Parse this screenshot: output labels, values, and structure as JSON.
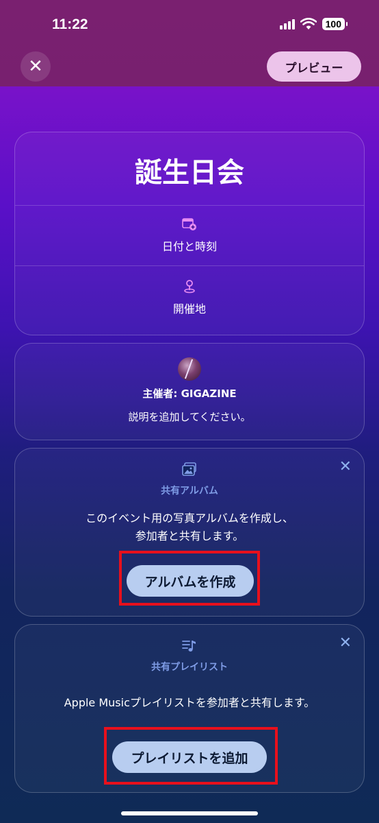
{
  "status": {
    "time": "11:22",
    "battery": "100"
  },
  "header": {
    "close_icon": "close-icon",
    "preview_label": "プレビュー"
  },
  "event": {
    "title": "誕生日会",
    "datetime_label": "日付と時刻",
    "location_label": "開催地"
  },
  "host": {
    "label": "主催者: GIGAZINE",
    "description": "説明を追加してください。"
  },
  "album": {
    "label": "共有アルバム",
    "text_line1": "このイベント用の写真アルバムを作成し、",
    "text_line2": "参加者と共有します。",
    "button": "アルバムを作成"
  },
  "playlist": {
    "label": "共有プレイリスト",
    "text": "Apple Musicプレイリストを参加者と共有します。",
    "button": "プレイリストを追加"
  },
  "colors": {
    "accent": "#b8cdf0",
    "highlight": "#e8101c",
    "preview_bg": "#ecc4ea"
  }
}
